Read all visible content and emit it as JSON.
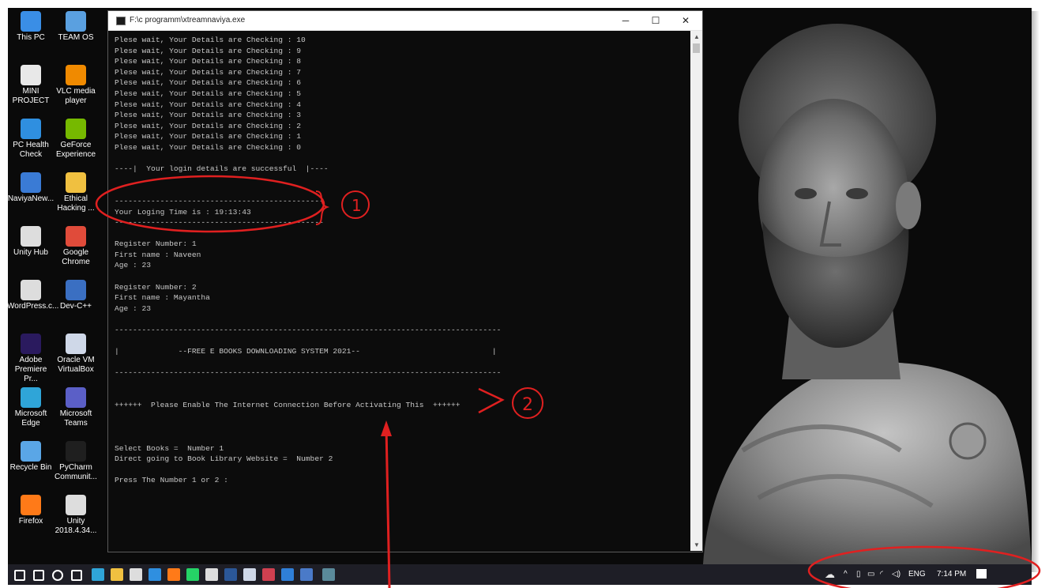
{
  "window": {
    "title": "F:\\c programm\\xtreamnaviya.exe",
    "minimize": "─",
    "maximize": "☐",
    "close": "✕"
  },
  "console": {
    "lines": [
      "Plese wait, Your Details are Checking : 10",
      "Plese wait, Your Details are Checking : 9",
      "Plese wait, Your Details are Checking : 8",
      "Plese wait, Your Details are Checking : 7",
      "Plese wait, Your Details are Checking : 6",
      "Plese wait, Your Details are Checking : 5",
      "Plese wait, Your Details are Checking : 4",
      "Plese wait, Your Details are Checking : 3",
      "Plese wait, Your Details are Checking : 2",
      "Plese wait, Your Details are Checking : 1",
      "Plese wait, Your Details are Checking : 0",
      "",
      "----|  Your login details are successful  |----",
      "",
      "",
      "----------------------------------------------",
      "Your Loging Time is : 19:13:43",
      "----------------------------------------------",
      "",
      "Register Number: 1",
      "First name : Naveen",
      "Age : 23",
      "",
      "Register Number: 2",
      "First name : Mayantha",
      "Age : 23",
      "",
      "-------------------------------------------------------------------------------------",
      "",
      "|             --FREE E BOOKS DOWNLOADING SYSTEM 2021--                             |",
      "",
      "-------------------------------------------------------------------------------------",
      "",
      "",
      "++++++  Please Enable The Internet Connection Before Activating This  ++++++",
      "",
      "",
      "",
      "Select Books =  Number 1",
      "Direct going to Book Library Website =  Number 2",
      "",
      "Press The Number 1 or 2 :"
    ]
  },
  "desktop_icons": [
    {
      "label": "This PC",
      "color": "#3a8ee6"
    },
    {
      "label": "TEAM OS",
      "color": "#5aa0e0"
    },
    {
      "label": "MINI PROJECT",
      "color": "#e8e8e8"
    },
    {
      "label": "VLC media player",
      "color": "#f08a00"
    },
    {
      "label": "PC Health Check",
      "color": "#2f8fe0"
    },
    {
      "label": "GeForce Experience",
      "color": "#76b900"
    },
    {
      "label": "NaviyaNew...",
      "color": "#3a7bd5"
    },
    {
      "label": "Ethical Hacking ...",
      "color": "#f0c040"
    },
    {
      "label": "Unity Hub",
      "color": "#dddddd"
    },
    {
      "label": "Google Chrome",
      "color": "#e04b3a"
    },
    {
      "label": "WordPress.c...",
      "color": "#dddddd"
    },
    {
      "label": "Dev-C++",
      "color": "#3a6fc2"
    },
    {
      "label": "Adobe Premiere Pr...",
      "color": "#2a1a5e"
    },
    {
      "label": "Oracle VM VirtualBox",
      "color": "#cfd8e8"
    },
    {
      "label": "Microsoft Edge",
      "color": "#2fa5d8"
    },
    {
      "label": "Microsoft Teams",
      "color": "#5b5fc7"
    },
    {
      "label": "Recycle Bin",
      "color": "#5aa6e6"
    },
    {
      "label": "PyCharm Communit...",
      "color": "#1f1f1f"
    },
    {
      "label": "Firefox",
      "color": "#ff7a18"
    },
    {
      "label": "Unity 2018.4.34...",
      "color": "#dddddd"
    }
  ],
  "taskbar": {
    "apps": [
      {
        "name": "start-icon",
        "color": "#ffffff"
      },
      {
        "name": "search-icon",
        "color": "#ffffff"
      },
      {
        "name": "cortana-icon",
        "color": "#ffffff"
      },
      {
        "name": "task-view-icon",
        "color": "#ffffff"
      },
      {
        "name": "edge-icon",
        "color": "#2fa5d8"
      },
      {
        "name": "file-explorer-icon",
        "color": "#f0c040"
      },
      {
        "name": "store-icon",
        "color": "#dddddd"
      },
      {
        "name": "mail-icon",
        "color": "#2f8fe0"
      },
      {
        "name": "firefox-icon",
        "color": "#ff7a18"
      },
      {
        "name": "whatsapp-icon",
        "color": "#25d366"
      },
      {
        "name": "unity-icon",
        "color": "#dddddd"
      },
      {
        "name": "word-icon",
        "color": "#2b5797"
      },
      {
        "name": "virtualbox-icon",
        "color": "#cfd8e8"
      },
      {
        "name": "app-red-icon",
        "color": "#d04050"
      },
      {
        "name": "app-blue-icon",
        "color": "#2f7fd8"
      },
      {
        "name": "app-window-icon",
        "color": "#4a7ac8"
      },
      {
        "name": "console-app-icon",
        "color": "#5a8a9a"
      }
    ],
    "tray": {
      "language": "ENG",
      "time": "7:14 PM"
    }
  },
  "annotations": {
    "label_1": "1",
    "label_2": "2",
    "color": "#e02020"
  }
}
